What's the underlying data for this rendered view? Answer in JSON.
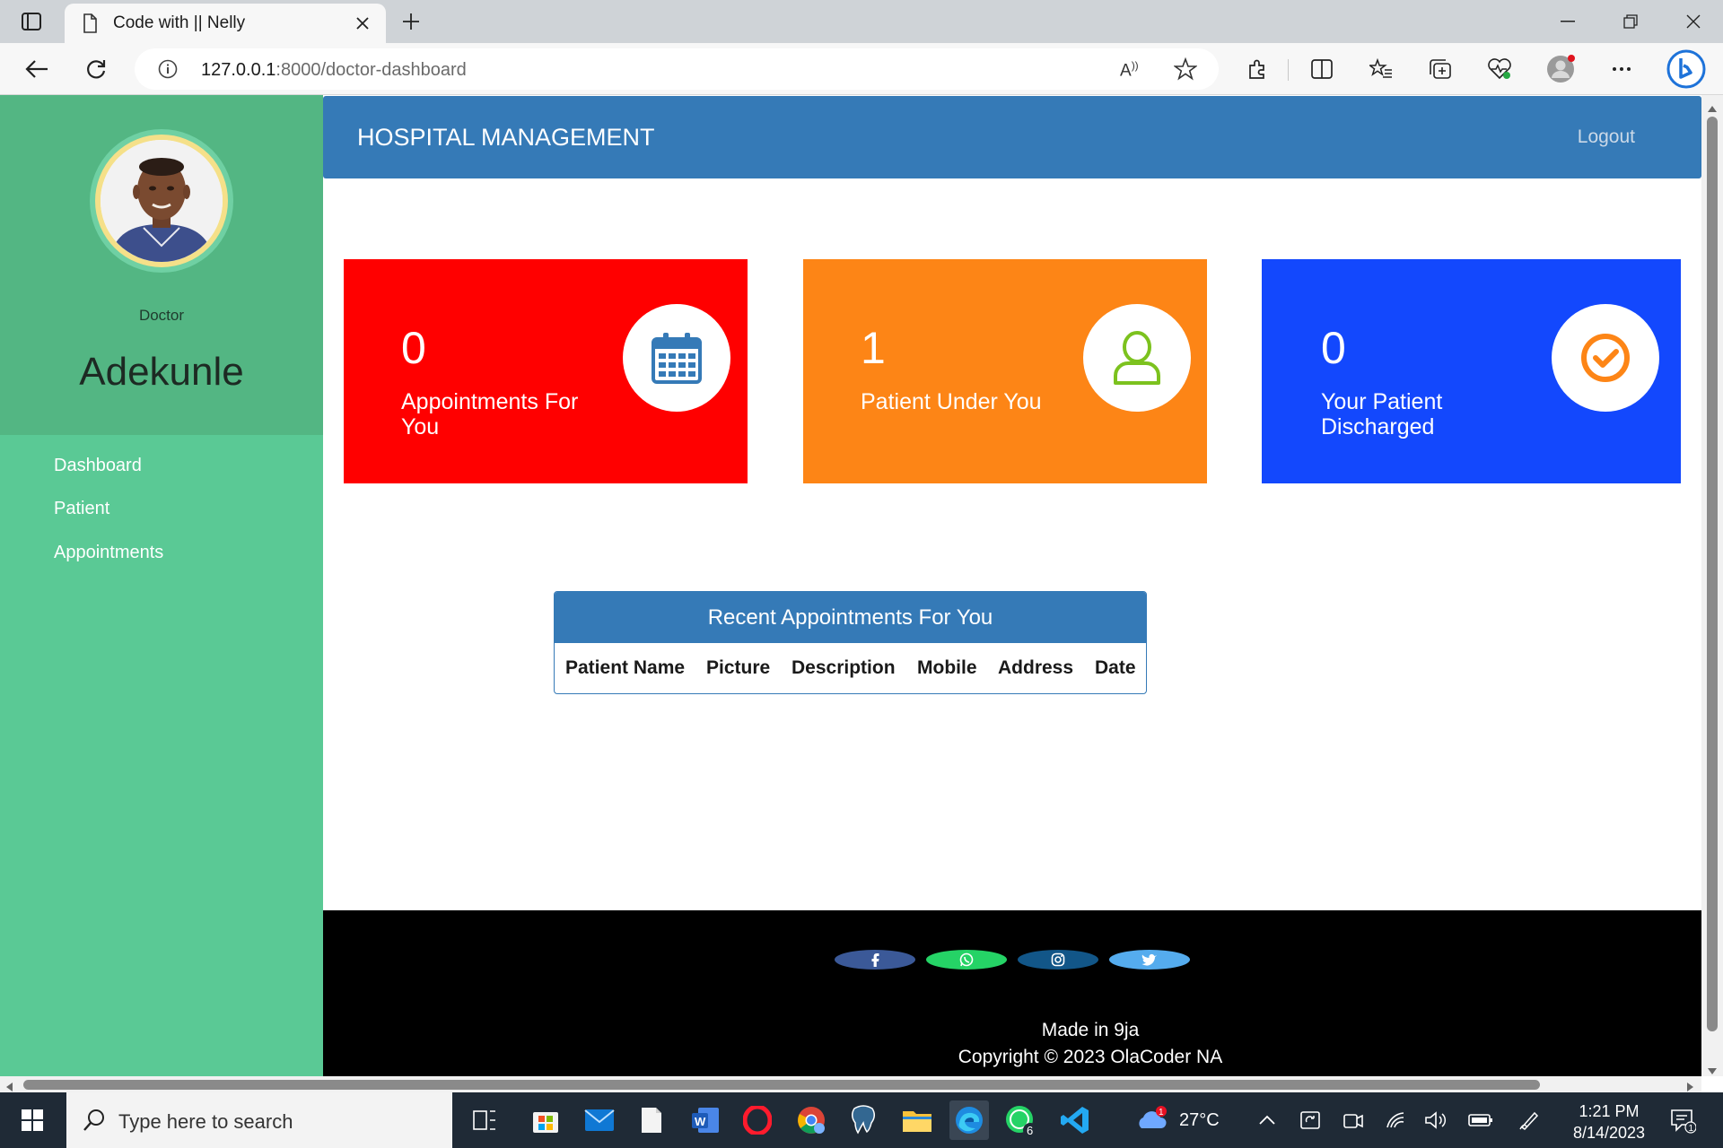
{
  "browser": {
    "tab_title": "Code with || Nelly",
    "url_host": "127.0.0.1",
    "url_path": ":8000/doctor-dashboard"
  },
  "sidebar": {
    "role": "Doctor",
    "name": "Adekunle",
    "items": [
      {
        "label": "Dashboard"
      },
      {
        "label": "Patient"
      },
      {
        "label": "Appointments"
      }
    ]
  },
  "header": {
    "title": "HOSPITAL MANAGEMENT",
    "logout": "Logout"
  },
  "cards": [
    {
      "value": "0",
      "label": "Appointments For You",
      "icon": "calendar-icon",
      "color": "#ff0000"
    },
    {
      "value": "1",
      "label": "Patient Under You",
      "icon": "user-icon",
      "color": "#fd8516"
    },
    {
      "value": "0",
      "label": "Your Patient Discharged",
      "icon": "check-circle-icon",
      "color": "#1348fd"
    }
  ],
  "appointments_table": {
    "title": "Recent Appointments For You",
    "columns": [
      "Patient Name",
      "Picture",
      "Description",
      "Mobile",
      "Address",
      "Date"
    ],
    "rows": []
  },
  "footer": {
    "socials": [
      "facebook-icon",
      "whatsapp-icon",
      "instagram-icon",
      "twitter-icon"
    ],
    "made_in": "Made in 9ja",
    "copyright": "Copyright © 2023 OlaCoder NA"
  },
  "taskbar": {
    "search_placeholder": "Type here to search",
    "temperature": "27°C",
    "time": "1:21 PM",
    "date": "8/14/2023"
  },
  "colors": {
    "sidebar": "#5ac995",
    "header": "#357ab7",
    "footer": "#000000"
  }
}
